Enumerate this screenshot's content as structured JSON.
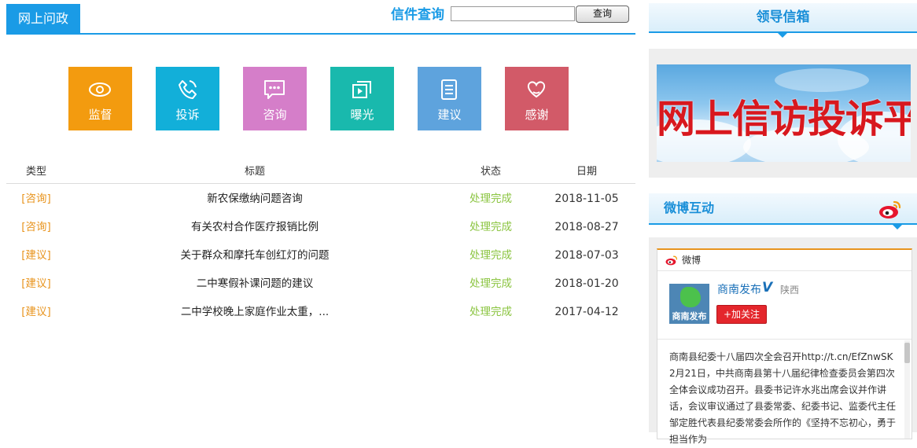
{
  "tab": {
    "label": "网上问政"
  },
  "query": {
    "label": "信件查询",
    "input_value": "",
    "button_label": "查询"
  },
  "icon_buttons": [
    {
      "label": "监督",
      "icon": "eye-icon",
      "color": "#f39b0f"
    },
    {
      "label": "投诉",
      "icon": "phone-icon",
      "color": "#12afd9"
    },
    {
      "label": "咨询",
      "icon": "chat-icon",
      "color": "#d57ec9"
    },
    {
      "label": "曝光",
      "icon": "play-window-icon",
      "color": "#19b9ad"
    },
    {
      "label": "建议",
      "icon": "document-icon",
      "color": "#5ea3dd"
    },
    {
      "label": "感谢",
      "icon": "heart-icon",
      "color": "#d25a68"
    }
  ],
  "table": {
    "headers": {
      "type": "类型",
      "title": "标题",
      "status": "状态",
      "date": "日期"
    },
    "rows": [
      {
        "type": "[咨询]",
        "title": "新农保缴纳问题咨询",
        "status": "处理完成",
        "date": "2018-11-05"
      },
      {
        "type": "[咨询]",
        "title": "有关农村合作医疗报销比例",
        "status": "处理完成",
        "date": "2018-08-27"
      },
      {
        "type": "[建议]",
        "title": "关于群众和摩托车创红灯的问题",
        "status": "处理完成",
        "date": "2018-07-03"
      },
      {
        "type": "[建议]",
        "title": "二中寒假补课问题的建议",
        "status": "处理完成",
        "date": "2018-01-20"
      },
      {
        "type": "[建议]",
        "title": "二中学校晚上家庭作业太重，...",
        "status": "处理完成",
        "date": "2017-04-12"
      }
    ]
  },
  "mailbox": {
    "title": "领导信箱",
    "banner_text": "网上信访投诉平台"
  },
  "weibo_section": {
    "title": "微博互动",
    "widget_label": "微博",
    "account_name": "商南发布",
    "verified_mark": "V",
    "location": "陕西",
    "avatar_text": "商南发布",
    "follow_label": "+加关注",
    "post_text": "商南县纪委十八届四次全会召开http://t.cn/EfZnwSK 2月21日，中共商南县第十八届纪律检查委员会第四次全体会议成功召开。县委书记许水兆出席会议并作讲话，会议审议通过了县委常委、纪委书记、监委代主任邹定胜代表县纪委常委会所作的《坚持不忘初心，勇于担当作为"
  }
}
